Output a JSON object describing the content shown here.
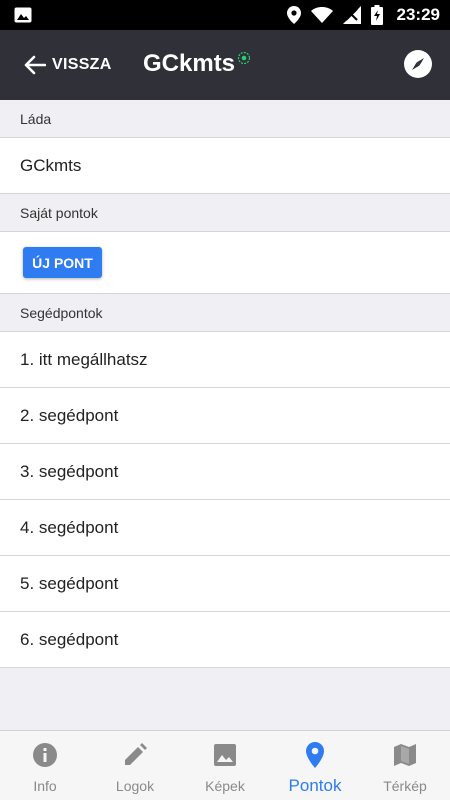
{
  "statusbar": {
    "time": "23:29"
  },
  "navbar": {
    "back_label": "VISSZA",
    "title": "GCkmts",
    "title_status_color": "#2ecc71"
  },
  "sections": {
    "lada": {
      "header": "Láda",
      "value": "GCkmts"
    },
    "sajat": {
      "header": "Saját pontok",
      "new_button": "ÚJ PONT"
    },
    "seged": {
      "header": "Segédpontok",
      "items": [
        "1. itt megállhatsz",
        "2. segédpont",
        "3. segédpont",
        "4. segédpont",
        "5. segédpont",
        "6. segédpont"
      ]
    }
  },
  "tabs": [
    {
      "label": "Info",
      "icon": "info-icon",
      "active": false
    },
    {
      "label": "Logok",
      "icon": "pencil-icon",
      "active": false
    },
    {
      "label": "Képek",
      "icon": "image-icon",
      "active": false
    },
    {
      "label": "Pontok",
      "icon": "map-pin-icon",
      "active": true
    },
    {
      "label": "Térkép",
      "icon": "map-icon",
      "active": false
    }
  ],
  "colors": {
    "accent": "#2f7cf2",
    "navbar": "#2f3038",
    "inactive_tab": "#8a8a8a"
  }
}
